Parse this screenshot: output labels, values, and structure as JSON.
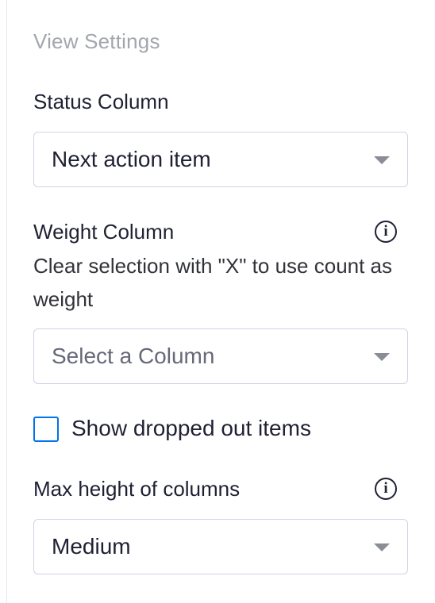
{
  "view_settings": {
    "title": "View Settings",
    "status_column": {
      "label": "Status Column",
      "value": "Next action item"
    },
    "weight_column": {
      "label": "Weight Column",
      "helper": "Clear selection with \"X\" to use count as weight",
      "placeholder": "Select a Column"
    },
    "show_dropped": {
      "label": "Show dropped out items",
      "checked": false
    },
    "max_height": {
      "label": "Max height of columns",
      "value": "Medium"
    }
  },
  "icons": {
    "info": "info-icon",
    "dropdown": "chevron-down-icon"
  },
  "colors": {
    "checkbox_border": "#0073ea",
    "muted_text": "#a3a6ad"
  }
}
